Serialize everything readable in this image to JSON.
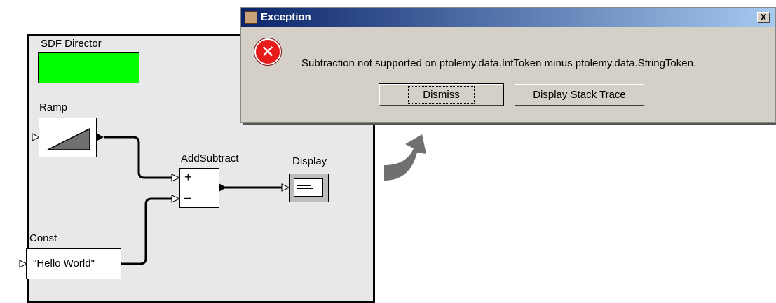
{
  "model": {
    "director_label": "SDF Director",
    "ramp_label": "Ramp",
    "addsubtract_label": "AddSubtract",
    "plus_sign": "+",
    "minus_sign": "–",
    "display_label": "Display",
    "const_label": "Const",
    "const_value": "\"Hello World\""
  },
  "dialog": {
    "title": "Exception",
    "close_glyph": "X",
    "error_glyph": "✕",
    "message": "Subtraction not supported on ptolemy.data.IntToken minus ptolemy.data.StringToken.",
    "dismiss_label": "Dismiss",
    "stack_trace_label": "Display Stack Trace"
  },
  "colors": {
    "director_fill": "#00ff00",
    "canvas_bg": "#e8e8e8",
    "arrow": "#707070",
    "error_red": "#e81b1b"
  }
}
